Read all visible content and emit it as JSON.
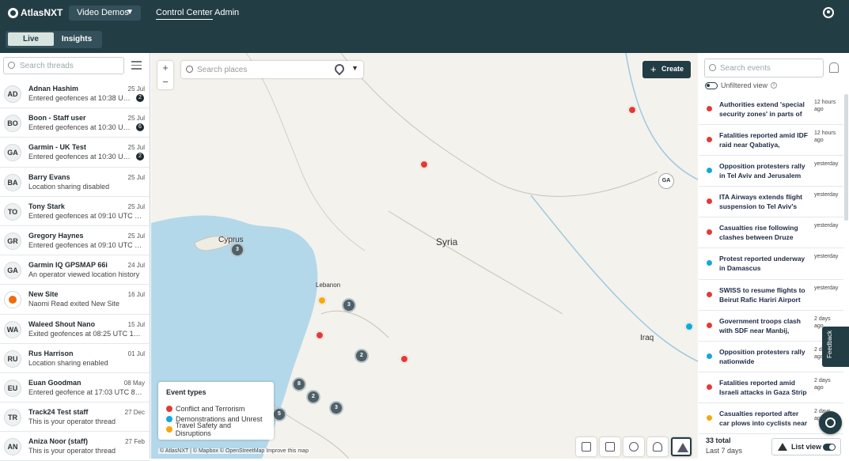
{
  "header": {
    "logo_text": "AtlasNXT",
    "demo_select": "Video Demos",
    "nav": [
      "Control Center",
      "Admin"
    ]
  },
  "subbar": {
    "tabs": [
      "Live",
      "Insights"
    ]
  },
  "threads": {
    "search_placeholder": "Search threads",
    "items": [
      {
        "initials": "AD",
        "name": "Adnan Hashim",
        "date": "25 Jul",
        "message": "Entered geofences at 10:38 UTC 25 Jul",
        "badge": "2"
      },
      {
        "initials": "BO",
        "name": "Boon - Staff user",
        "date": "25 Jul",
        "message": "Entered geofences at 10:30 UTC 25 Jul",
        "badge": "6"
      },
      {
        "initials": "GA",
        "name": "Garmin - UK Test",
        "date": "25 Jul",
        "message": "Entered geofences at 10:30 UTC 25 Jul",
        "badge": "2"
      },
      {
        "initials": "BA",
        "name": "Barry Evans",
        "date": "25 Jul",
        "message": "Location sharing disabled",
        "badge": ""
      },
      {
        "initials": "TO",
        "name": "Tony Stark",
        "date": "25 Jul",
        "message": "Entered geofences at 09:10 UTC 25 Jul",
        "badge": ""
      },
      {
        "initials": "GR",
        "name": "Gregory Haynes",
        "date": "25 Jul",
        "message": "Entered geofences at 09:10 UTC 25 Jul",
        "badge": ""
      },
      {
        "initials": "GA",
        "name": "Garmin IQ GPSMAP 66i",
        "date": "24 Jul",
        "message": "An operator viewed location history",
        "badge": ""
      },
      {
        "initials": "",
        "name": "New Site",
        "date": "16 Jul",
        "message": "Naomi Read exited New Site",
        "badge": "",
        "site": true
      },
      {
        "initials": "WA",
        "name": "Waleed Shout Nano",
        "date": "15 Jul",
        "message": "Exited geofences at 08:25 UTC 15 Jul",
        "badge": ""
      },
      {
        "initials": "RU",
        "name": "Rus Harrison",
        "date": "01 Jul",
        "message": "Location sharing enabled",
        "badge": ""
      },
      {
        "initials": "EU",
        "name": "Euan Goodman",
        "date": "08 May",
        "message": "Entered geofence at 17:03 UTC 8 May",
        "badge": ""
      },
      {
        "initials": "TR",
        "name": "Track24 Test staff",
        "date": "27 Dec",
        "message": "This is your operator thread",
        "badge": ""
      },
      {
        "initials": "AN",
        "name": "Aniza Noor (staff)",
        "date": "27 Feb",
        "message": "This is your operator thread",
        "badge": ""
      }
    ]
  },
  "map": {
    "search_placeholder": "Search places",
    "create_label": "Create",
    "labels": {
      "cyprus": "Cyprus",
      "syria": "Syria",
      "lebanon": "Lebanon",
      "iraq": "Iraq"
    },
    "clusters": [
      "3",
      "3",
      "2",
      "8",
      "2",
      "3",
      "5"
    ],
    "user_pin": "GA",
    "attribution": "© AtlasNXT | © Mapbox © OpenStreetMap  Improve this map",
    "legend": {
      "title": "Event types",
      "items": [
        {
          "label": "Conflict and Terrorism",
          "color": "#e53935"
        },
        {
          "label": "Demonstrations and Unrest",
          "color": "#12a9d8"
        },
        {
          "label": "Travel Safety and Disruptions",
          "color": "#f4a90c"
        }
      ]
    }
  },
  "events": {
    "search_placeholder": "Search events",
    "unfiltered_label": "Unfiltered view",
    "items": [
      {
        "title": "Authorities extend 'special security zones' in parts of",
        "time": "12 hours ago",
        "color": "#e53935"
      },
      {
        "title": "Fatalities reported amid IDF raid near Qabatiya,",
        "time": "12 hours ago",
        "color": "#e53935"
      },
      {
        "title": "Opposition protesters rally in Tel Aviv and Jerusalem",
        "time": "yesterday",
        "color": "#12a9d8"
      },
      {
        "title": "ITA Airways extends flight suspension to Tel Aviv's",
        "time": "yesterday",
        "color": "#e53935"
      },
      {
        "title": "Casualties rise following clashes between Druze",
        "time": "yesterday",
        "color": "#e53935"
      },
      {
        "title": "Protest reported underway in Damascus",
        "time": "yesterday",
        "color": "#12a9d8"
      },
      {
        "title": "SWISS to resume flights to Beirut Rafic Hariri Airport",
        "time": "yesterday",
        "color": "#e53935"
      },
      {
        "title": "Government troops clash with SDF near Manbij,",
        "time": "2 days ago",
        "color": "#e53935"
      },
      {
        "title": "Opposition protesters rally nationwide",
        "time": "2 days ago",
        "color": "#12a9d8"
      },
      {
        "title": "Fatalities reported amid Israeli attacks in Gaza Strip",
        "time": "2 days ago",
        "color": "#e53935"
      },
      {
        "title": "Casualties reported after car plows into cyclists near",
        "time": "2 days ago",
        "color": "#f4a90c"
      }
    ],
    "total": "33 total",
    "period": "Last 7 days",
    "list_view_label": "List view",
    "feedback_label": "Feedback"
  }
}
